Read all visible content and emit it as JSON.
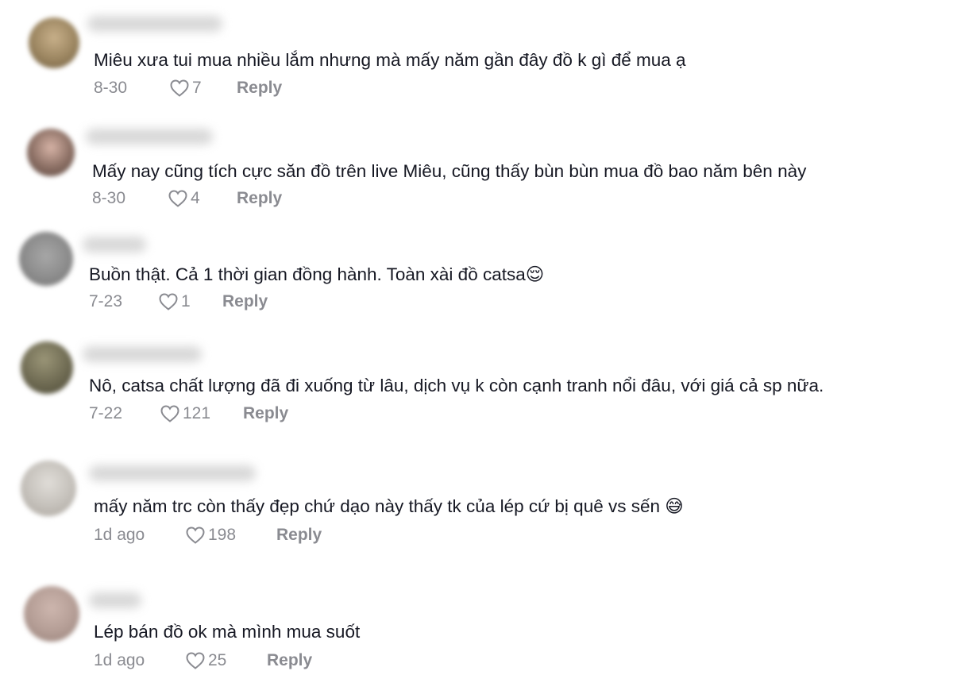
{
  "comments": [
    {
      "text": "Miêu xưa tui mua nhiều lắm nhưng mà mấy năm gần đây đồ k gì để mua ạ",
      "date": "8-30",
      "likes": "7",
      "reply": "Reply",
      "avatar_color": "#9b8560"
    },
    {
      "text": "Mấy nay cũng tích cực săn đồ trên live Miêu, cũng thấy bùn bùn mua đồ bao năm bên này",
      "date": "8-30",
      "likes": "4",
      "reply": "Reply",
      "avatar_color": "#8a6e63"
    },
    {
      "text": "Buồn thật. Cả 1 thời gian đồng hành. Toàn xài đồ catsa",
      "emoji": "😌",
      "date": "7-23",
      "likes": "1",
      "reply": "Reply",
      "avatar_color": "#8c8c8c"
    },
    {
      "text": "Nô, catsa chất lượng đã đi xuống từ lâu, dịch vụ k còn cạnh tranh nổi đâu, với giá cả sp nữa.",
      "date": "7-22",
      "likes": "121",
      "reply": "Reply",
      "avatar_color": "#6e6a52"
    },
    {
      "text": "mấy năm trc còn thấy đẹp chứ dạo này thấy tk của lép cứ bị quê vs sến",
      "emoji": "😅",
      "date": "1d ago",
      "likes": "198",
      "reply": "Reply",
      "avatar_color": "#c4c0ba"
    },
    {
      "text": "Lép bán đồ ok mà mình mua suốt",
      "date": "1d ago",
      "likes": "25",
      "reply": "Reply",
      "avatar_color": "#b49d95"
    }
  ],
  "colors": {
    "text": "#161823",
    "meta": "#8a8b91",
    "background": "#ffffff"
  },
  "icons": {
    "like": "heart-outline-icon"
  }
}
